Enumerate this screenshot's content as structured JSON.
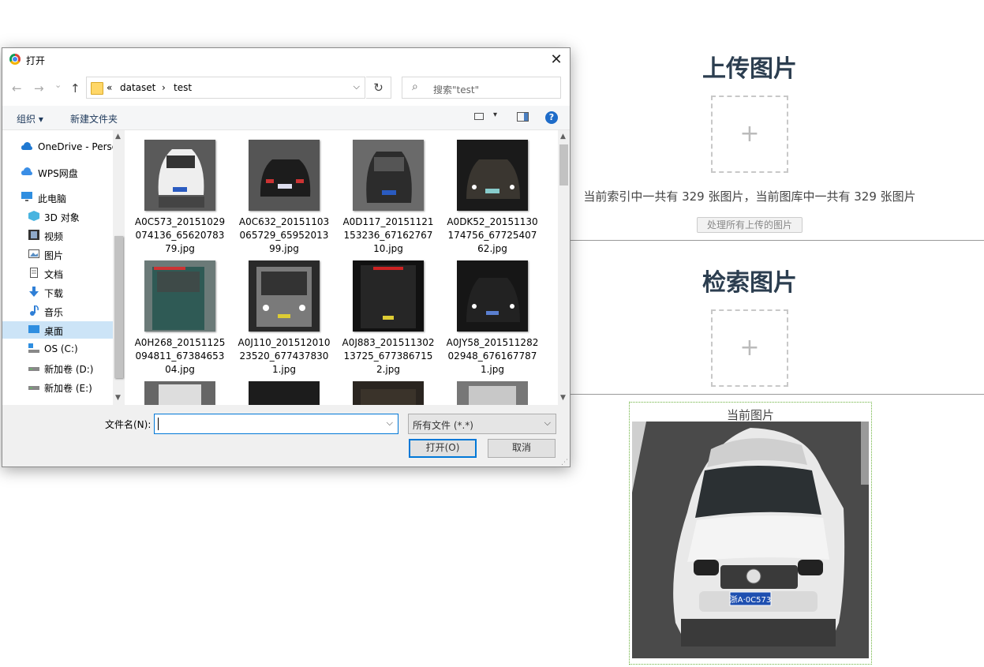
{
  "page": {
    "upload_title": "上传图片",
    "plus": "+",
    "count_text": "当前索引中一共有 329 张图片，当前图库中一共有 329 张图片",
    "process_button": "处理所有上传的图片",
    "search_title": "检索图片",
    "current_label": "当前图片",
    "current_plate": "浙A·0C573"
  },
  "dialog": {
    "title": "打开",
    "close": "✕",
    "nav": {
      "back": "←",
      "forward": "→",
      "down": "⌄",
      "up": "↑",
      "refresh": "↻"
    },
    "breadcrumb": {
      "sep_start": "«",
      "folder1": "dataset",
      "sep": "›",
      "folder2": "test"
    },
    "search_placeholder": "搜索\"test\"",
    "toolbar": {
      "organize": "组织 ▾",
      "new_folder": "新建文件夹",
      "help": "?"
    },
    "nav_items": [
      {
        "label": "OneDrive - Personal",
        "icon": "cloud-icon"
      },
      {
        "label": "WPS网盘",
        "icon": "wps-cloud-icon"
      },
      {
        "label": "此电脑",
        "icon": "computer-icon"
      },
      {
        "label": "3D 对象",
        "icon": "3d-objects-icon"
      },
      {
        "label": "视频",
        "icon": "video-icon"
      },
      {
        "label": "图片",
        "icon": "pictures-icon"
      },
      {
        "label": "文档",
        "icon": "documents-icon"
      },
      {
        "label": "下载",
        "icon": "download-icon"
      },
      {
        "label": "音乐",
        "icon": "music-icon"
      },
      {
        "label": "桌面",
        "icon": "desktop-icon"
      },
      {
        "label": "OS (C:)",
        "icon": "drive-c-icon"
      },
      {
        "label": "新加卷 (D:)",
        "icon": "drive-icon"
      },
      {
        "label": "新加卷 (E:)",
        "icon": "drive-icon"
      }
    ],
    "files": [
      {
        "name": "A0C573_20151029074136_6562078379.jpg"
      },
      {
        "name": "A0C632_20151103065729_6595201399.jpg"
      },
      {
        "name": "A0D117_20151121153236_6716276710.jpg"
      },
      {
        "name": "A0DK52_20151130174756_6772540762.jpg"
      },
      {
        "name": "A0H268_20151125094811_6738465304.jpg"
      },
      {
        "name": "A0J110_20151201023520_6774378301.jpg"
      },
      {
        "name": "A0J883_20151130213725_6773867152.jpg"
      },
      {
        "name": "A0JY58_20151128202948_6761677871.jpg"
      }
    ],
    "filename_label": "文件名(N):",
    "filename_value": "",
    "filetype": "所有文件 (*.*)",
    "open_button": "打开(O)",
    "cancel_button": "取消"
  }
}
